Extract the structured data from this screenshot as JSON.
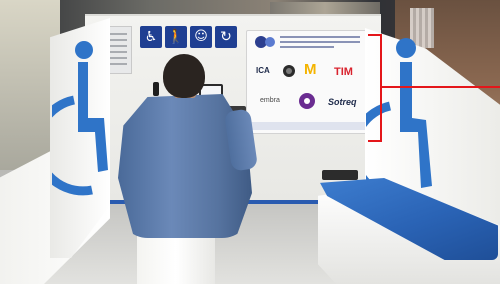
{
  "scene": {
    "kind": "photograph",
    "sponsor_board": {
      "logos": [
        {
          "text": "ICA",
          "color": "#1e2a4a"
        },
        {
          "text": "M",
          "color": "#f4b400"
        },
        {
          "text": "TIM",
          "color": "#d9232e"
        },
        {
          "text": "embra",
          "color": "#4a4a4a"
        },
        {
          "text": "Sotreq",
          "color": "#1e2a4a"
        }
      ]
    },
    "wheelchair_symbol_color": "#2f74c8",
    "bench_color": "#2a63b5",
    "annotation_color": "#e4161a",
    "icons": [
      "wheelchair-icon",
      "walking-person-icon",
      "pregnant-icon",
      "elderly-icon"
    ]
  }
}
